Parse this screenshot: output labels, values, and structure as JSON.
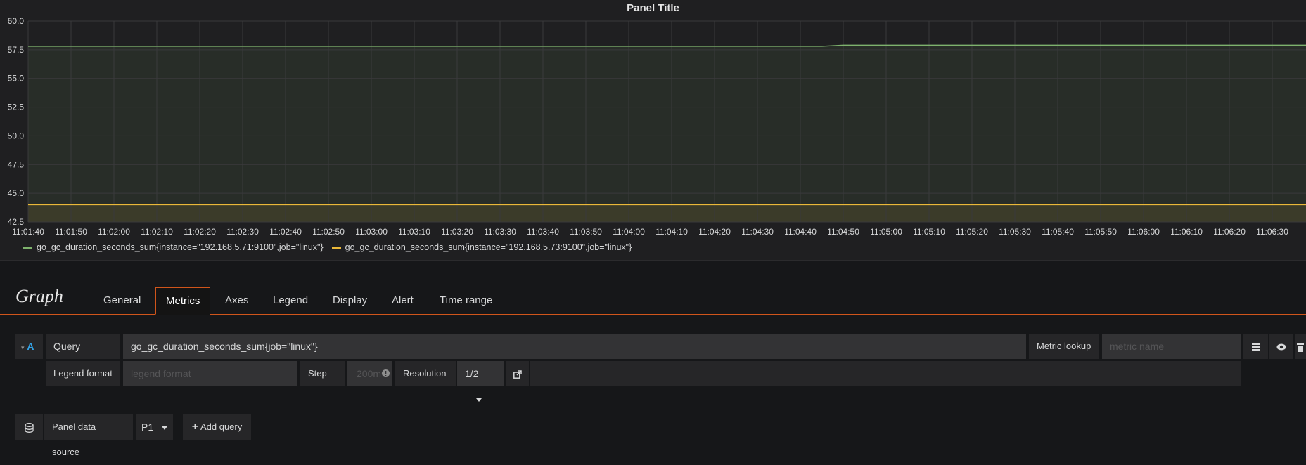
{
  "panel": {
    "title": "Panel Title"
  },
  "chart_data": {
    "type": "line",
    "ylim": [
      42.5,
      60.0
    ],
    "yticks": [
      "60.0",
      "57.5",
      "55.0",
      "52.5",
      "50.0",
      "47.5",
      "45.0",
      "42.5"
    ],
    "xticks": [
      "11:01:40",
      "11:01:50",
      "11:02:00",
      "11:02:10",
      "11:02:20",
      "11:02:30",
      "11:02:40",
      "11:02:50",
      "11:03:00",
      "11:03:10",
      "11:03:20",
      "11:03:30",
      "11:03:40",
      "11:03:50",
      "11:04:00",
      "11:04:10",
      "11:04:20",
      "11:04:30",
      "11:04:40",
      "11:04:50",
      "11:05:00",
      "11:05:10",
      "11:05:20",
      "11:05:30",
      "11:05:40",
      "11:05:50",
      "11:06:00",
      "11:06:10",
      "11:06:20",
      "11:06:30"
    ],
    "grid": true,
    "fill": true,
    "series": [
      {
        "name": "go_gc_duration_seconds_sum{instance=\"192.168.5.71:9100\",job=\"linux\"}",
        "color": "#7eb26d",
        "points": [
          [
            "11:01:40",
            57.8
          ],
          [
            "11:04:45",
            57.8
          ],
          [
            "11:04:50",
            57.9
          ],
          [
            "11:06:40",
            57.9
          ]
        ]
      },
      {
        "name": "go_gc_duration_seconds_sum{instance=\"192.168.5.73:9100\",job=\"linux\"}",
        "color": "#eab839",
        "points": [
          [
            "11:01:40",
            44.0
          ],
          [
            "11:06:40",
            44.0
          ]
        ]
      }
    ]
  },
  "editor": {
    "title": "Graph",
    "tabs": [
      "General",
      "Metrics",
      "Axes",
      "Legend",
      "Display",
      "Alert",
      "Time range"
    ],
    "active_tab": "Metrics"
  },
  "query": {
    "ref_id": "A",
    "query_label": "Query",
    "query_value": "go_gc_duration_seconds_sum{job=\"linux\"}",
    "metric_lookup_label": "Metric lookup",
    "metric_name_placeholder": "metric name",
    "legend_format_label": "Legend format",
    "legend_format_placeholder": "legend format",
    "step_label": "Step",
    "step_placeholder": "200ms",
    "resolution_label": "Resolution",
    "resolution_value": "1/2"
  },
  "footer": {
    "panel_data_source_label": "Panel data source",
    "data_source_value": "P1",
    "add_query_label": "Add query"
  },
  "icons": {
    "menu": "hamburger-icon",
    "eye": "eye-icon",
    "trash": "trash-icon",
    "info": "info-icon",
    "share": "external-link-icon",
    "database": "database-icon",
    "plus": "plus-icon"
  }
}
